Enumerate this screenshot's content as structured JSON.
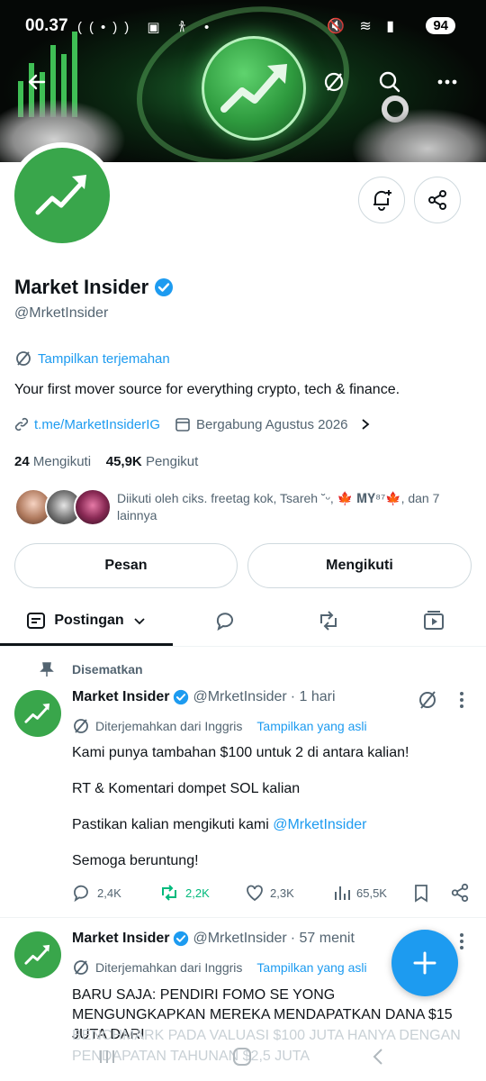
{
  "status_bar": {
    "time": "00.37",
    "left_icons": "((•)) ▣ 𐀪 •",
    "right_icons": "🔇 ≋ ▮",
    "battery": "94"
  },
  "banner": {
    "description_icon": "chart-arrow-icon"
  },
  "profile": {
    "name": "Market Insider",
    "handle": "@MrketInsider",
    "show_translation": "Tampilkan terjemahan",
    "bio": "Your first mover source for everything crypto, tech & finance.",
    "link": "t.me/MarketInsiderIG",
    "joined": "Bergabung Agustus 2026",
    "following_count": "24",
    "following_label": "Mengikuti",
    "followers_count": "45,9K",
    "followers_label": "Pengikut",
    "followed_by": "Diikuti oleh ciks. freetag kok, Tsareh ˘ᵕ, 🍁 𝐌𝐘⁸⁷🍁, dan 7 lainnya"
  },
  "buttons": {
    "message": "Pesan",
    "following": "Mengikuti"
  },
  "tabs": {
    "posts": "Postingan"
  },
  "posts": [
    {
      "pinned_label": "Disematkan",
      "name": "Market Insider",
      "handle": "@MrketInsider",
      "time": "· 1 hari",
      "translated_from": "Diterjemahkan dari Inggris",
      "show_original": "Tampilkan yang asli",
      "line1": "Kami punya tambahan $100 untuk 2 di antara kalian!",
      "line2": "RT & Komentari dompet SOL kalian",
      "line3": "Pastikan kalian mengikuti kami ",
      "mention": "@MrketInsider",
      "line4": "Semoga beruntung!",
      "replies": "2,4K",
      "reposts": "2,2K",
      "likes": "2,3K",
      "views": "65,5K"
    },
    {
      "name": "Market Insider",
      "handle": "@MrketInsider",
      "time": "· 57 menit",
      "translated_from": "Diterjemahkan dari Inggris",
      "show_original": "Tampilkan yang asli",
      "text": "BARU SAJA: PENDIRI FOMO SE YONG MENGUNGKAPKAN MEREKA MENDAPATKAN DANA $15 JUTA DARI",
      "text_faded": "BENCHMARK PADA VALUASI $100 JUTA HANYA DENGAN PENDAPATAN TAHUNAN $2,5 JUTA"
    }
  ],
  "colors": {
    "accent": "#1d9bf0",
    "brand_green": "#39a64b",
    "repost_green": "#00ba7c"
  }
}
